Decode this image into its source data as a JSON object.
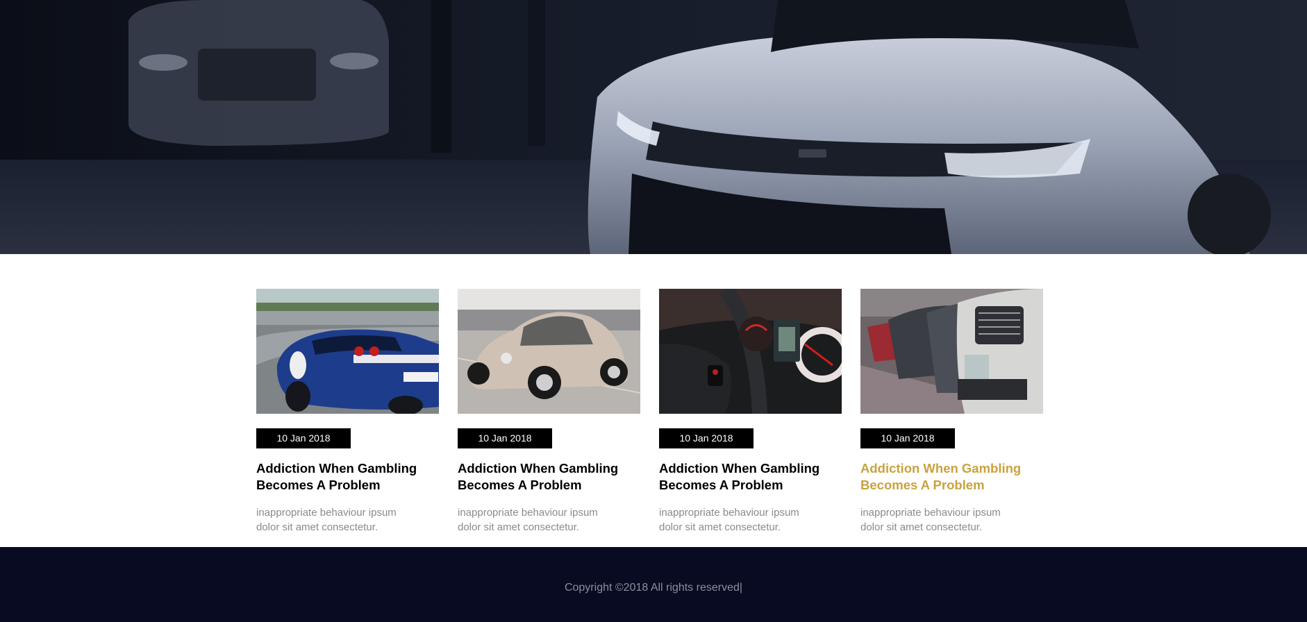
{
  "hero": {
    "image": "sports-car-garage-photo"
  },
  "posts": [
    {
      "image": "blue-race-car-photo",
      "date": "10 Jan 2018",
      "title_line1": "Addiction When Gambling",
      "title_line2": "Becomes A Problem",
      "excerpt": "inappropriate behaviour ipsum dolor sit amet consectetur.",
      "highlighted": false
    },
    {
      "image": "vintage-beetle-photo",
      "date": "10 Jan 2018",
      "title_line1": "Addiction When Gambling",
      "title_line2": "Becomes A Problem",
      "excerpt": "inappropriate behaviour ipsum dolor sit amet consectetur.",
      "highlighted": false
    },
    {
      "image": "dashboard-steering-photo",
      "date": "10 Jan 2018",
      "title_line1": "Addiction When Gambling",
      "title_line2": "Becomes A Problem",
      "excerpt": "inappropriate behaviour ipsum dolor sit amet consectetur.",
      "highlighted": false
    },
    {
      "image": "parked-cars-row-photo",
      "date": "10 Jan 2018",
      "title_line1": "Addiction When Gambling",
      "title_line2": "Becomes A Problem",
      "excerpt": "inappropriate behaviour ipsum dolor sit amet consectetur.",
      "highlighted": true
    }
  ],
  "footer": {
    "copyright": "Copyright ©2018 All rights reserved|"
  },
  "colors": {
    "accent": "#c9a23f",
    "footer_bg": "#080b21",
    "badge_bg": "#000000"
  }
}
